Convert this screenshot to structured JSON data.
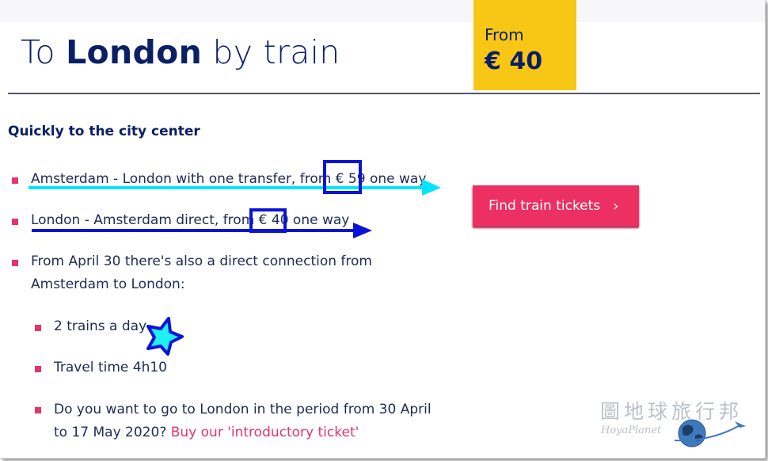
{
  "header": {
    "title_prefix": "To ",
    "title_city": "London",
    "title_suffix": " by train",
    "price_label": "From",
    "price_value": "€ 40"
  },
  "section": {
    "heading": "Quickly to the city center"
  },
  "bullets": [
    "Amsterdam - London with one transfer, from € 59 one way",
    "London - Amsterdam direct, from € 40 one way",
    "From April 30 there's also a direct connection from",
    "Amsterdam to London:"
  ],
  "sub_bullets": [
    "2 trains a day",
    "Travel time 4h10",
    "Do you want to go to London in the period from 30 April",
    "to 17 May 2020? "
  ],
  "link": {
    "label": "Buy our 'introductory ticket'"
  },
  "cta": {
    "label": "Find train tickets",
    "chevron": "›"
  },
  "watermark": {
    "line1": "圖地球旅行邦",
    "line2": "HoyaPlanet"
  },
  "colors": {
    "brand_navy": "#0b1f66",
    "accent_yellow": "#f8c716",
    "accent_pink": "#ec3063",
    "annotation_cyan": "#00e5ff",
    "annotation_blue": "#0a14d6"
  }
}
